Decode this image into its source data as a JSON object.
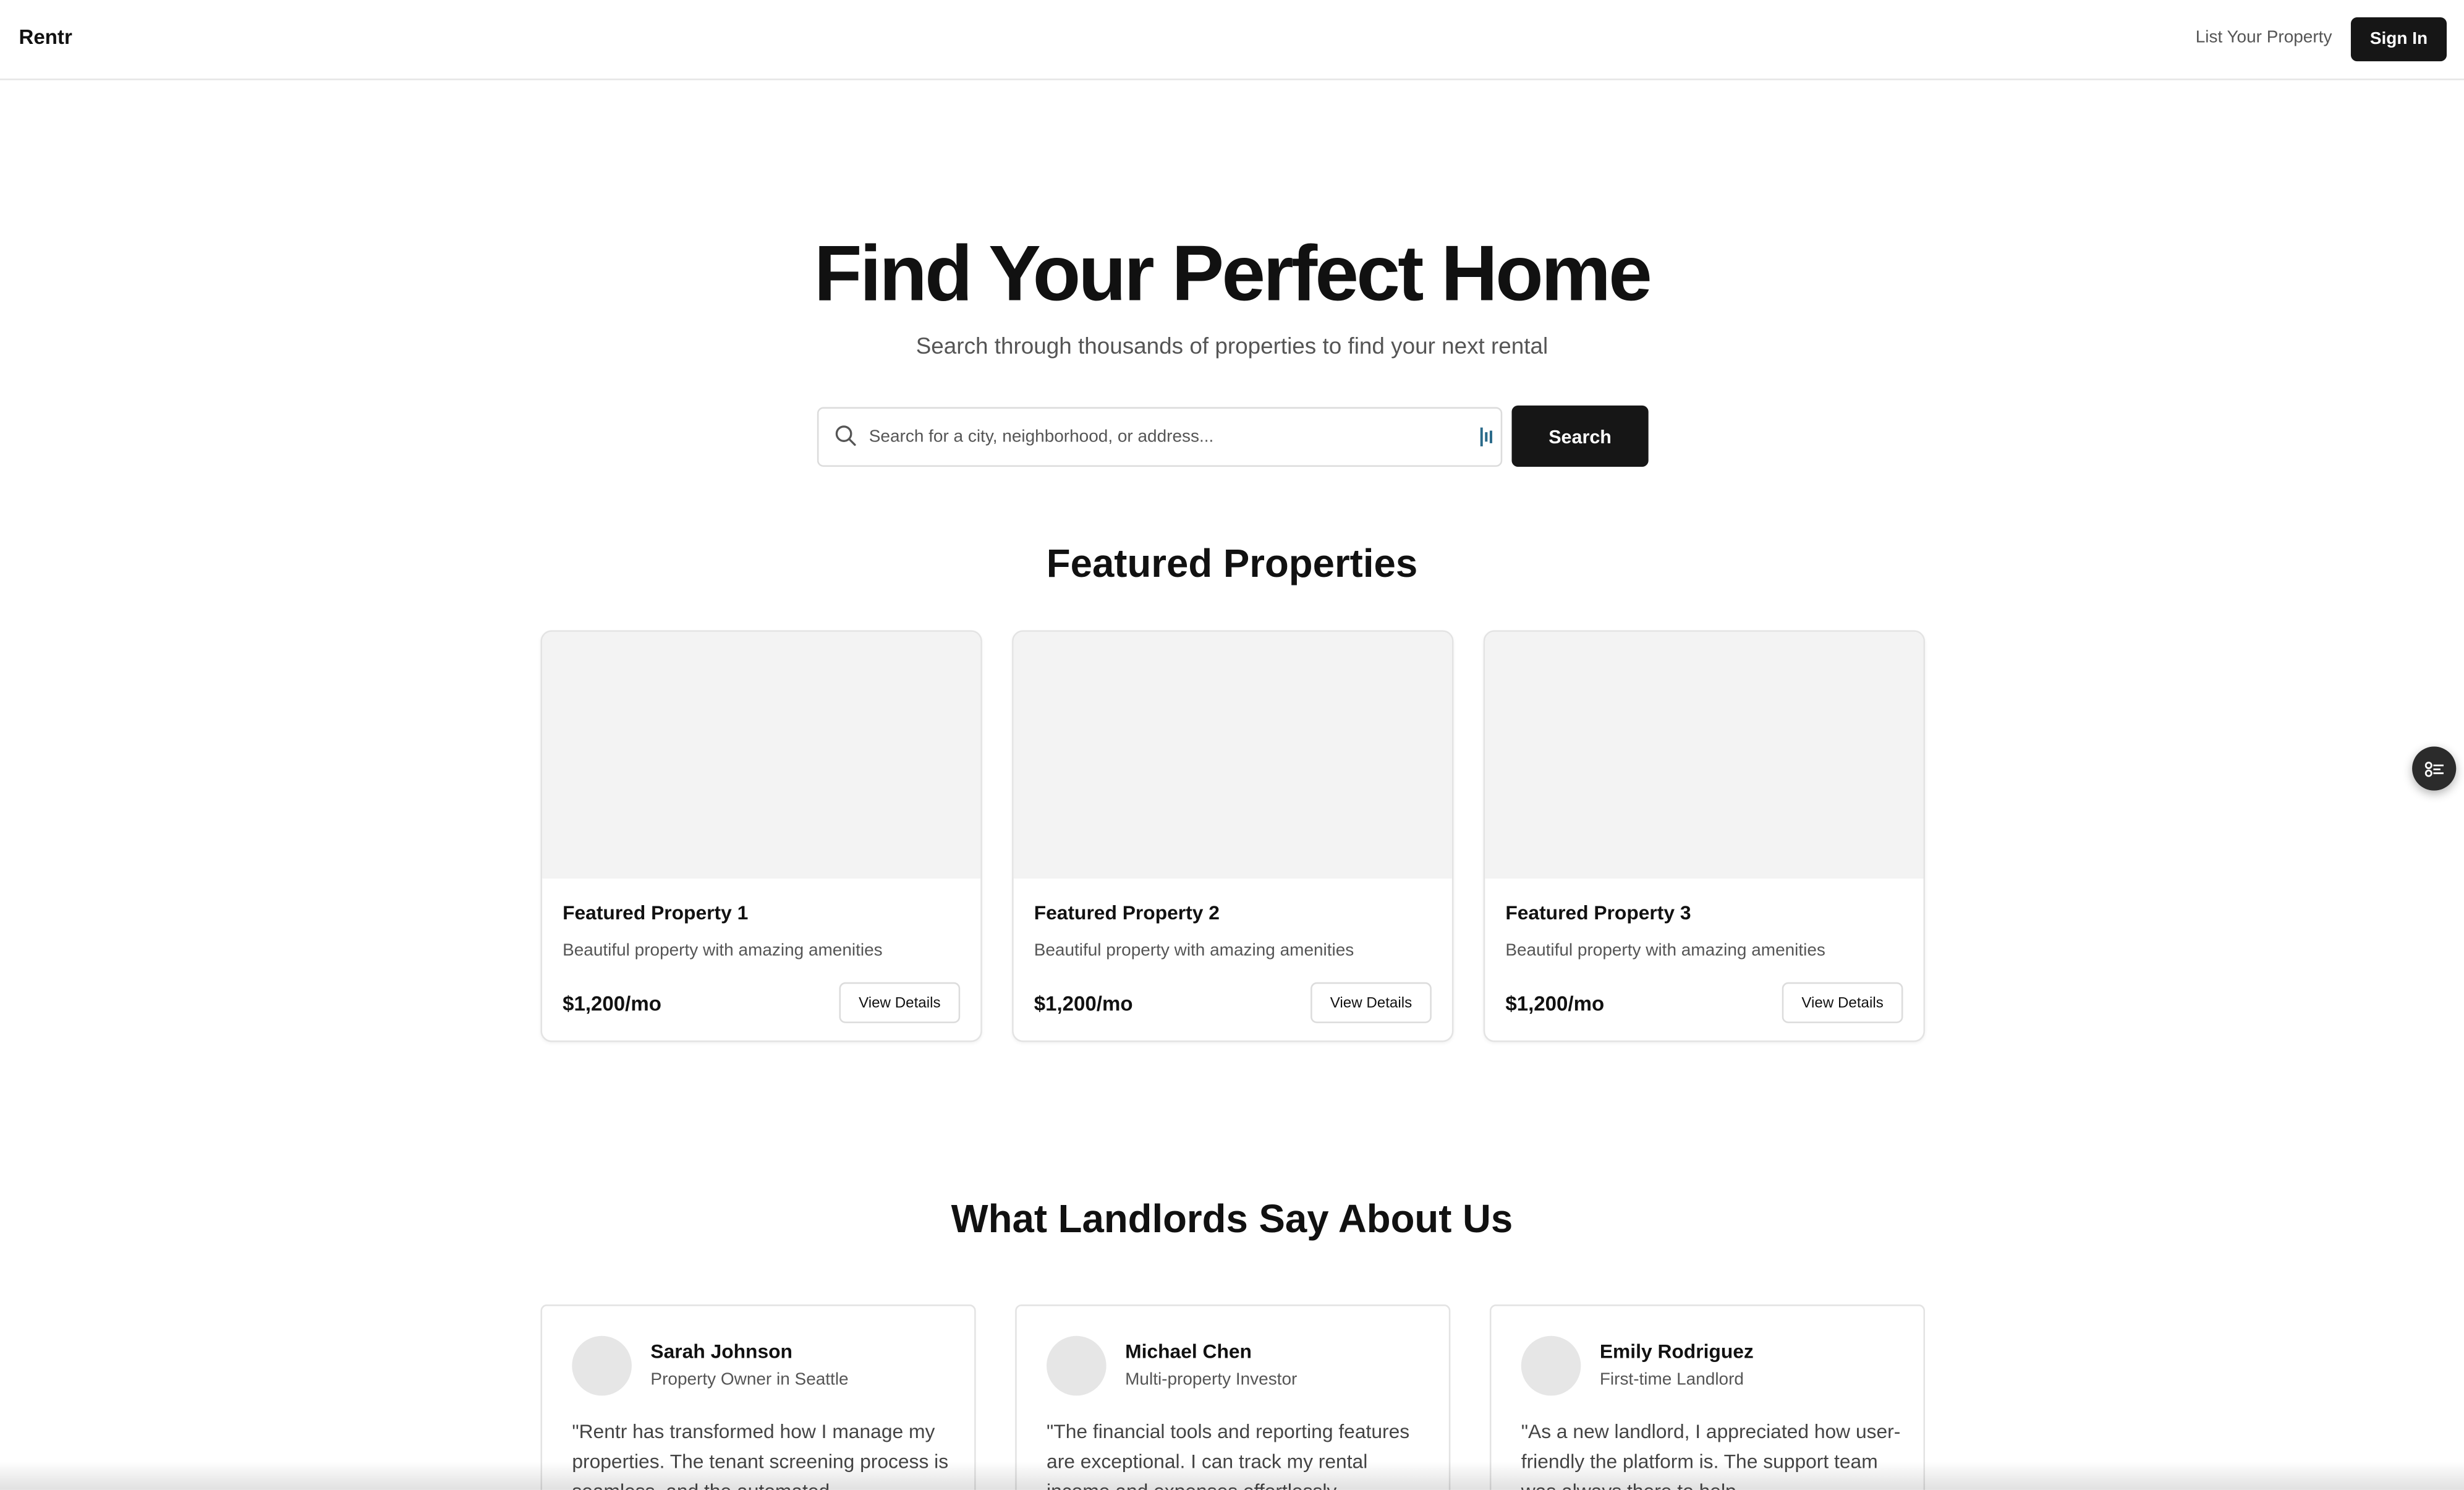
{
  "header": {
    "brand": "Rentr",
    "list_property": "List Your Property",
    "sign_in": "Sign In"
  },
  "hero": {
    "title": "Find Your Perfect Home",
    "subtitle": "Search through thousands of properties to find your next rental",
    "search_placeholder": "Search for a city, neighborhood, or address...",
    "search_button": "Search"
  },
  "featured": {
    "title": "Featured Properties",
    "cards": [
      {
        "title": "Featured Property 1",
        "description": "Beautiful property with amazing amenities",
        "price": "$1,200/mo",
        "button": "View Details"
      },
      {
        "title": "Featured Property 2",
        "description": "Beautiful property with amazing amenities",
        "price": "$1,200/mo",
        "button": "View Details"
      },
      {
        "title": "Featured Property 3",
        "description": "Beautiful property with amazing amenities",
        "price": "$1,200/mo",
        "button": "View Details"
      }
    ]
  },
  "testimonials": {
    "title": "What Landlords Say About Us",
    "items": [
      {
        "name": "Sarah Johnson",
        "role": "Property Owner in Seattle",
        "quote": "\"Rentr has transformed how I manage my properties. The tenant screening process is seamless, and the automated"
      },
      {
        "name": "Michael Chen",
        "role": "Multi-property Investor",
        "quote": "\"The financial tools and reporting features are exceptional. I can track my rental income and expenses effortlessly"
      },
      {
        "name": "Emily Rodriguez",
        "role": "First-time Landlord",
        "quote": "\"As a new landlord, I appreciated how user-friendly the platform is. The support team was always there to help"
      }
    ]
  },
  "icons": {
    "search": "search-icon",
    "voice": "bars-icon",
    "floating": "settings-sliders-icon"
  },
  "colors": {
    "primary_button": "#161616",
    "card_border": "#e3e3e3",
    "image_placeholder": "#f3f3f3",
    "muted_text": "#555555"
  }
}
